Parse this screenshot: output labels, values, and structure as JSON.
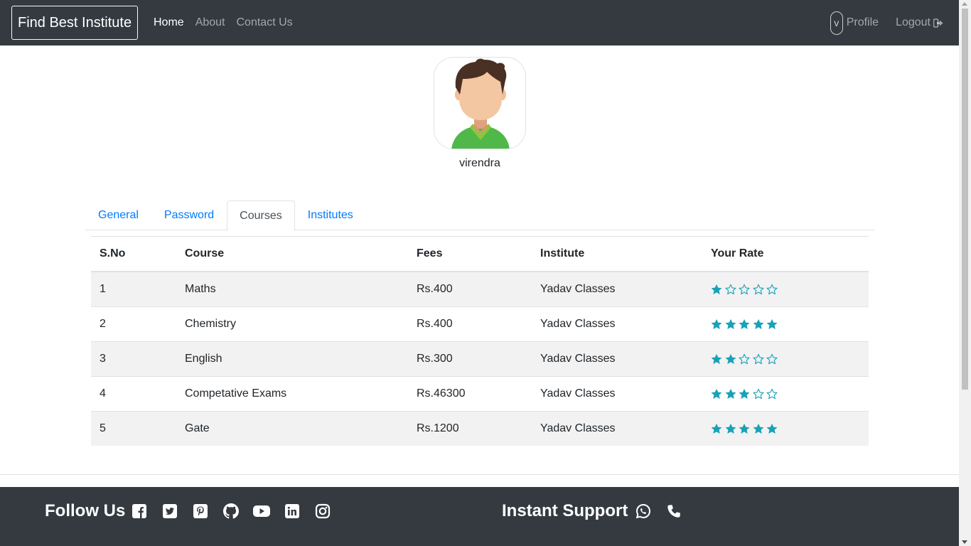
{
  "navbar": {
    "brand": "Find Best Institute",
    "links": [
      {
        "label": "Home",
        "active": true
      },
      {
        "label": "About",
        "active": false
      },
      {
        "label": "Contact Us",
        "active": false
      }
    ],
    "profile_initial": "v",
    "profile_label": "Profile",
    "logout_label": "Logout"
  },
  "profile": {
    "username": "virendra"
  },
  "tabs": [
    {
      "label": "General",
      "active": false
    },
    {
      "label": "Password",
      "active": false
    },
    {
      "label": "Courses",
      "active": true
    },
    {
      "label": "Institutes",
      "active": false
    }
  ],
  "courses_table": {
    "headers": [
      "S.No",
      "Course",
      "Fees",
      "Institute",
      "Your Rate"
    ],
    "rows": [
      {
        "sno": "1",
        "course": "Maths",
        "fees": "Rs.400",
        "institute": "Yadav Classes",
        "rating": 1
      },
      {
        "sno": "2",
        "course": "Chemistry",
        "fees": "Rs.400",
        "institute": "Yadav Classes",
        "rating": 5
      },
      {
        "sno": "3",
        "course": "English",
        "fees": "Rs.300",
        "institute": "Yadav Classes",
        "rating": 2
      },
      {
        "sno": "4",
        "course": "Competative Exams",
        "fees": "Rs.46300",
        "institute": "Yadav Classes",
        "rating": 3
      },
      {
        "sno": "5",
        "course": "Gate",
        "fees": "Rs.1200",
        "institute": "Yadav Classes",
        "rating": 5
      }
    ],
    "rating_max": 5
  },
  "footer": {
    "follow_label": "Follow Us",
    "social_icons": [
      "facebook-icon",
      "twitter-icon",
      "pinterest-icon",
      "github-icon",
      "youtube-icon",
      "linkedin-icon",
      "instagram-icon"
    ],
    "support_label": "Instant Support",
    "support_icons": [
      "whatsapp-icon",
      "phone-icon"
    ]
  },
  "colors": {
    "navbar_bg": "#343a40",
    "link_blue": "#007bff",
    "star_color": "#17a2b8",
    "stripe_bg": "#f2f2f2"
  }
}
